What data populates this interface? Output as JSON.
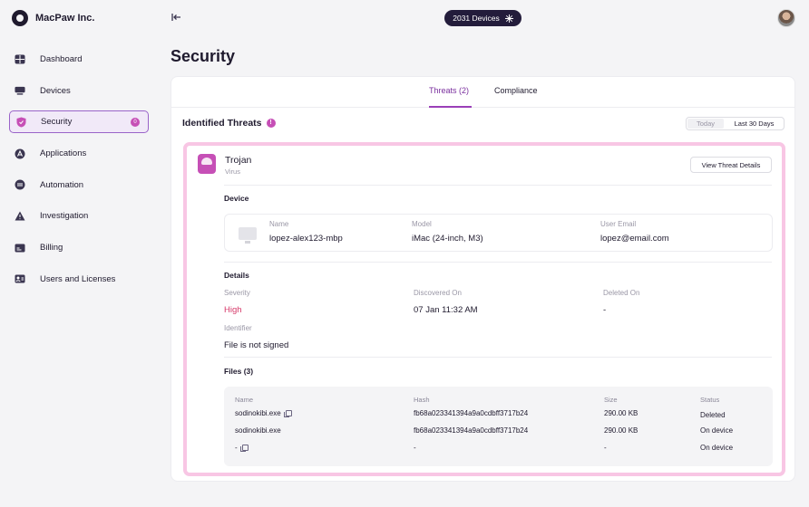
{
  "app": {
    "org_name": "MacPaw Inc."
  },
  "header": {
    "device_count_label": "2031 Devices"
  },
  "sidebar": {
    "items": [
      {
        "label": "Dashboard",
        "icon": "grid-icon"
      },
      {
        "label": "Devices",
        "icon": "laptop-icon"
      },
      {
        "label": "Security",
        "icon": "shield-icon",
        "badge": "0",
        "active": true
      },
      {
        "label": "Applications",
        "icon": "apps-icon"
      },
      {
        "label": "Automation",
        "icon": "automation-icon"
      },
      {
        "label": "Investigation",
        "icon": "warning-icon"
      },
      {
        "label": "Billing",
        "icon": "billing-icon"
      },
      {
        "label": "Users and Licenses",
        "icon": "users-icon"
      }
    ]
  },
  "page": {
    "title": "Security"
  },
  "tabs": {
    "threats": "Threats (2)",
    "compliance": "Compliance"
  },
  "threats": {
    "heading": "Identified Threats",
    "info_icon_label": "!",
    "range_today": "Today",
    "range_30": "Last 30 Days"
  },
  "threat": {
    "name": "Trojan",
    "type": "Virus",
    "view_details": "View Threat Details",
    "device_section": "Device",
    "device": {
      "name_label": "Name",
      "name": "lopez-alex123-mbp",
      "model_label": "Model",
      "model": "iMac (24-inch, M3)",
      "email_label": "User Email",
      "email": "lopez@email.com"
    },
    "details_section": "Details",
    "details": {
      "severity_label": "Severity",
      "severity": "High",
      "discovered_label": "Discovered On",
      "discovered": "07 Jan 11:32 AM",
      "deleted_label": "Deleted On",
      "deleted": "-",
      "identifier_label": "Identifier",
      "identifier": "File is not signed"
    },
    "files_section": "Files (3)",
    "files_headers": {
      "name": "Name",
      "hash": "Hash",
      "size": "Size",
      "status": "Status"
    },
    "files": [
      {
        "name": "sodinokibi.exe",
        "hash": "fb68a023341394a9a0cdbff3717b24",
        "size": "290.00 KB",
        "status": "Deleted"
      },
      {
        "name": "sodinokibi.exe",
        "hash": "fb68a023341394a9a0cdbff3717b24",
        "size": "290.00 KB",
        "status": "On device"
      },
      {
        "name": "-",
        "hash": "-",
        "size": "-",
        "status": "On device"
      }
    ]
  },
  "colors": {
    "accent": "#9a3fb8",
    "badge": "#c64fb6",
    "highlight_border": "#f8c6e4",
    "severity_high": "#d63a6a"
  }
}
